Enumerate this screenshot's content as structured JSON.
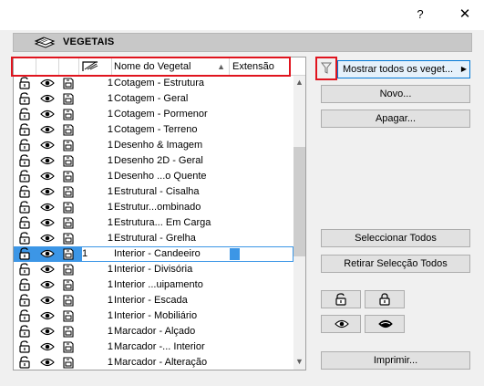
{
  "titlebar": {
    "help": "?",
    "close": "✕"
  },
  "header": {
    "title": "VEGETAIS"
  },
  "columns": {
    "name": "Nome do Vegetal",
    "extension": "Extensão"
  },
  "toolbar": {
    "show_all": "Mostrar todos os veget...",
    "new": "Novo...",
    "delete": "Apagar...",
    "select_all": "Seleccionar Todos",
    "deselect_all": "Retirar Selecção Todos",
    "print": "Imprimir..."
  },
  "rows": [
    {
      "num": "1",
      "name": "Cotagem - Estrutura"
    },
    {
      "num": "1",
      "name": "Cotagem - Geral"
    },
    {
      "num": "1",
      "name": "Cotagem - Pormenor"
    },
    {
      "num": "1",
      "name": "Cotagem - Terreno"
    },
    {
      "num": "1",
      "name": "Desenho & Imagem"
    },
    {
      "num": "1",
      "name": "Desenho 2D - Geral"
    },
    {
      "num": "1",
      "name": "Desenho ...o Quente"
    },
    {
      "num": "1",
      "name": "Estrutural - Cisalha"
    },
    {
      "num": "1",
      "name": "Estrutur...ombinado"
    },
    {
      "num": "1",
      "name": "Estrutura... Em Carga"
    },
    {
      "num": "1",
      "name": "Estrutural - Grelha"
    },
    {
      "num": "1",
      "name": "Interior - Candeeiro",
      "selected": true
    },
    {
      "num": "1",
      "name": "Interior - Divisória"
    },
    {
      "num": "1",
      "name": "Interior ...uipamento"
    },
    {
      "num": "1",
      "name": "Interior - Escada"
    },
    {
      "num": "1",
      "name": "Interior - Mobiliário"
    },
    {
      "num": "1",
      "name": "Marcador - Alçado"
    },
    {
      "num": "1",
      "name": "Marcador -... Interior"
    },
    {
      "num": "1",
      "name": "Marcador - Alteração"
    }
  ],
  "icons": {
    "header": "layers-icon",
    "lock": "lock-icon",
    "visibility": "eye-icon",
    "layer": "layer-sheet-icon",
    "intersection": "intersection-group-icon",
    "filter": "filter-icon"
  },
  "colors": {
    "highlight": "#e0141e",
    "selection": "#3c96e6",
    "accent": "#0078d7"
  }
}
